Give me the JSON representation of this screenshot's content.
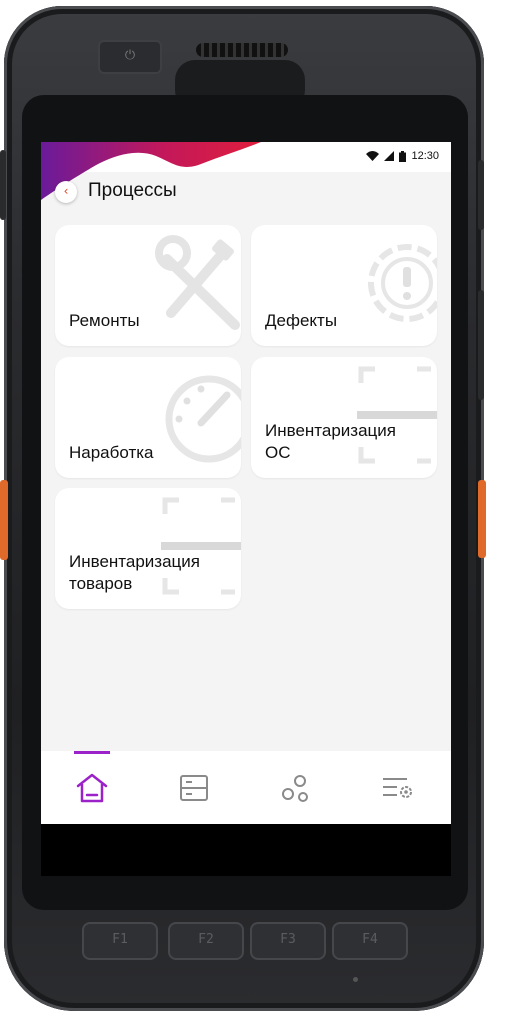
{
  "status": {
    "time": "12:30"
  },
  "appbar": {
    "title": "Процессы",
    "back_icon": "‹"
  },
  "tiles": [
    {
      "label": "Ремонты",
      "icon": "wrench-screwdriver-icon"
    },
    {
      "label": "Дефекты",
      "icon": "gear-alert-icon"
    },
    {
      "label": "Наработка",
      "icon": "gauge-icon"
    },
    {
      "label": "Инвентаризация\nОС",
      "icon": "barcode-scan-icon"
    },
    {
      "label": "Инвентаризация\nтоваров",
      "icon": "barcode-scan-icon"
    }
  ],
  "navbar": {
    "items": [
      {
        "name": "home",
        "icon": "home-icon",
        "active": true
      },
      {
        "name": "documents",
        "icon": "documents-icon",
        "active": false
      },
      {
        "name": "network",
        "icon": "network-icon",
        "active": false
      },
      {
        "name": "settings",
        "icon": "settings-list-icon",
        "active": false
      }
    ],
    "accent": "#9b22c9"
  },
  "device": {
    "fkeys": [
      "F1",
      "F2",
      "F3",
      "F4"
    ],
    "power_symbol": "⏻"
  },
  "colors": {
    "accent_red": "#e01e3c",
    "accent_purple": "#6a1b9a",
    "screen_bg": "#f4f4f4",
    "icon_grey": "#e2e2e2"
  }
}
